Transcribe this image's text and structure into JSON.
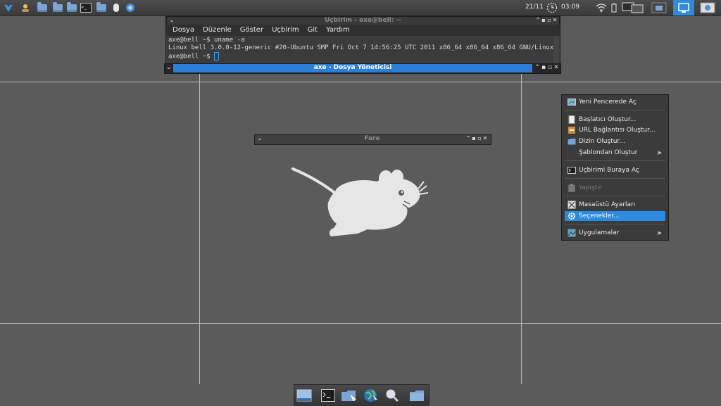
{
  "panel": {
    "date": "21/11",
    "time": "03:09"
  },
  "terminal": {
    "title": "Uçbirim - axe@bell: ~",
    "menu": [
      "Dosya",
      "Düzenle",
      "Göster",
      "Uçbirim",
      "Git",
      "Yardım"
    ],
    "lines": [
      "axe@bell ~$ uname -a",
      "Linux bell 3.0.0-12-generic #20-Ubuntu SMP Fri Oct 7 14:56:25 UTC 2011 x86_64 x86_64 x86_64 GNU/Linux",
      "axe@bell ~$ "
    ]
  },
  "file_manager": {
    "title": "axe - Dosya Yöneticisi"
  },
  "mouse_window": {
    "title": "Fare"
  },
  "context_menu": {
    "items": [
      {
        "label": "Yeni Pencerede Aç",
        "icon": "new-window-icon"
      },
      {
        "label": "Başlatıcı Oluştur...",
        "icon": "launcher-icon"
      },
      {
        "label": "URL Bağlantısı Oluştur...",
        "icon": "url-link-icon"
      },
      {
        "label": "Dizin Oluştur...",
        "icon": "folder-icon"
      },
      {
        "label": "Şablondan Oluştur",
        "icon": "",
        "submenu": true
      },
      {
        "label": "Uçbirimi Buraya Aç",
        "icon": "terminal-icon"
      },
      {
        "label": "Yapıştır",
        "icon": "paste-icon",
        "disabled": true
      },
      {
        "label": "Masaüstü Ayarları",
        "icon": "desktop-settings-icon"
      },
      {
        "label": "Seçenekler...",
        "icon": "gear-icon",
        "selected": true
      },
      {
        "label": "Uygulamalar",
        "icon": "applications-icon",
        "submenu": true
      }
    ]
  },
  "colors": {
    "accent": "#2a8be0",
    "desktop": "#5b5b5b",
    "panel": "#3a3a3a"
  }
}
